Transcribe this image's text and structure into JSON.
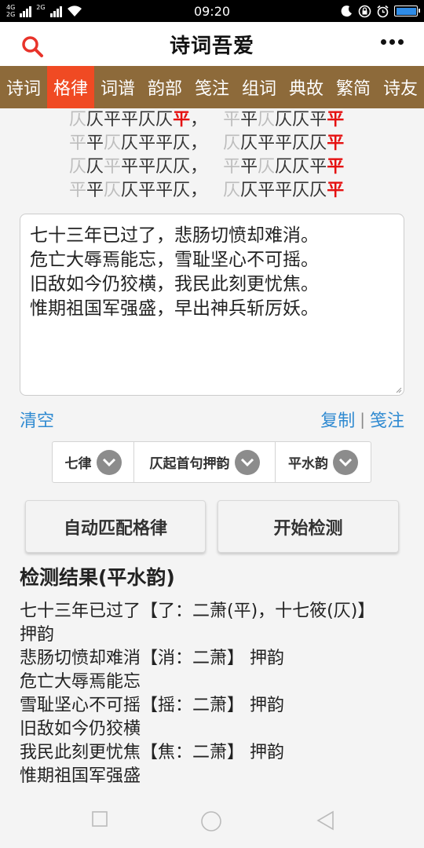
{
  "status_bar": {
    "network_top": "4G",
    "network_bottom": "2G",
    "network2_top": "2G",
    "time": "09:20"
  },
  "header": {
    "title": "诗词吾爱"
  },
  "tabs": [
    {
      "label": "诗词",
      "active": false
    },
    {
      "label": "格律",
      "active": true
    },
    {
      "label": "词谱",
      "active": false
    },
    {
      "label": "韵部",
      "active": false
    },
    {
      "label": "笺注",
      "active": false
    },
    {
      "label": "组词",
      "active": false
    },
    {
      "label": "典故",
      "active": false
    },
    {
      "label": "繁简",
      "active": false
    },
    {
      "label": "诗友",
      "active": false
    }
  ],
  "pattern": {
    "comma": "，",
    "lines": [
      {
        "first": [
          [
            "仄",
            "g"
          ],
          [
            "仄",
            "b"
          ],
          [
            "平",
            "b"
          ],
          [
            "平",
            "b"
          ],
          [
            "仄",
            "b"
          ],
          [
            "仄",
            "b"
          ],
          [
            "平",
            "r"
          ]
        ],
        "second": [
          [
            "平",
            "g"
          ],
          [
            "平",
            "b"
          ],
          [
            "仄",
            "g"
          ],
          [
            "仄",
            "b"
          ],
          [
            "仄",
            "b"
          ],
          [
            "平",
            "b"
          ],
          [
            "平",
            "r"
          ]
        ]
      },
      {
        "first": [
          [
            "平",
            "g"
          ],
          [
            "平",
            "b"
          ],
          [
            "仄",
            "g"
          ],
          [
            "仄",
            "b"
          ],
          [
            "平",
            "b"
          ],
          [
            "平",
            "b"
          ],
          [
            "仄",
            "b"
          ]
        ],
        "second": [
          [
            "仄",
            "g"
          ],
          [
            "仄",
            "b"
          ],
          [
            "平",
            "b"
          ],
          [
            "平",
            "b"
          ],
          [
            "仄",
            "b"
          ],
          [
            "仄",
            "b"
          ],
          [
            "平",
            "r"
          ]
        ]
      },
      {
        "first": [
          [
            "仄",
            "g"
          ],
          [
            "仄",
            "b"
          ],
          [
            "平",
            "g"
          ],
          [
            "平",
            "b"
          ],
          [
            "平",
            "b"
          ],
          [
            "仄",
            "b"
          ],
          [
            "仄",
            "b"
          ]
        ],
        "second": [
          [
            "平",
            "g"
          ],
          [
            "平",
            "b"
          ],
          [
            "仄",
            "g"
          ],
          [
            "仄",
            "b"
          ],
          [
            "仄",
            "b"
          ],
          [
            "平",
            "b"
          ],
          [
            "平",
            "r"
          ]
        ]
      },
      {
        "first": [
          [
            "平",
            "g"
          ],
          [
            "平",
            "b"
          ],
          [
            "仄",
            "g"
          ],
          [
            "仄",
            "b"
          ],
          [
            "平",
            "b"
          ],
          [
            "平",
            "b"
          ],
          [
            "仄",
            "b"
          ]
        ],
        "second": [
          [
            "仄",
            "g"
          ],
          [
            "仄",
            "b"
          ],
          [
            "平",
            "b"
          ],
          [
            "平",
            "b"
          ],
          [
            "仄",
            "b"
          ],
          [
            "仄",
            "b"
          ],
          [
            "平",
            "r"
          ]
        ]
      }
    ]
  },
  "poem": {
    "lines": [
      "七十三年已过了，悲肠切愤却难消。",
      "危亡大辱焉能忘，雪耻坚心不可摇。",
      "旧敌如今仍狡横，我民此刻更忧焦。",
      "惟期祖国军强盛，早出神兵斩厉妖。"
    ]
  },
  "links": {
    "clear": "清空",
    "copy": "复制",
    "separator": "|",
    "annotate": "笺注"
  },
  "selects": {
    "form": "七律",
    "start": "仄起首句押韵",
    "rhyme": "平水韵"
  },
  "buttons": {
    "auto_match": "自动匹配格律",
    "start_check": "开始检测"
  },
  "result": {
    "title": "检测结果(平水韵)",
    "lines": [
      "七十三年已过了【了：二萧(平)，十七筱(仄)】",
      "押韵",
      "悲肠切愤却难消【消：二萧】 押韵",
      "危亡大辱焉能忘",
      "雪耻坚心不可摇【摇：二萧】 押韵",
      "旧敌如今仍狡横",
      "我民此刻更忧焦【焦：二萧】 押韵",
      "惟期祖国军强盛"
    ]
  },
  "colors": {
    "nav_bar": "#8d6a3a",
    "nav_active": "#f04a23",
    "link": "#2f8ad1",
    "rhyme_red": "#e51010",
    "search_icon": "#e8332a"
  },
  "icons": {
    "search": "search-icon",
    "more": "more-dots-icon",
    "dropdown": "chevron-down-icon",
    "nav_back": "back-triangle-icon",
    "nav_home": "home-circle-icon",
    "nav_recent": "recent-square-icon"
  }
}
